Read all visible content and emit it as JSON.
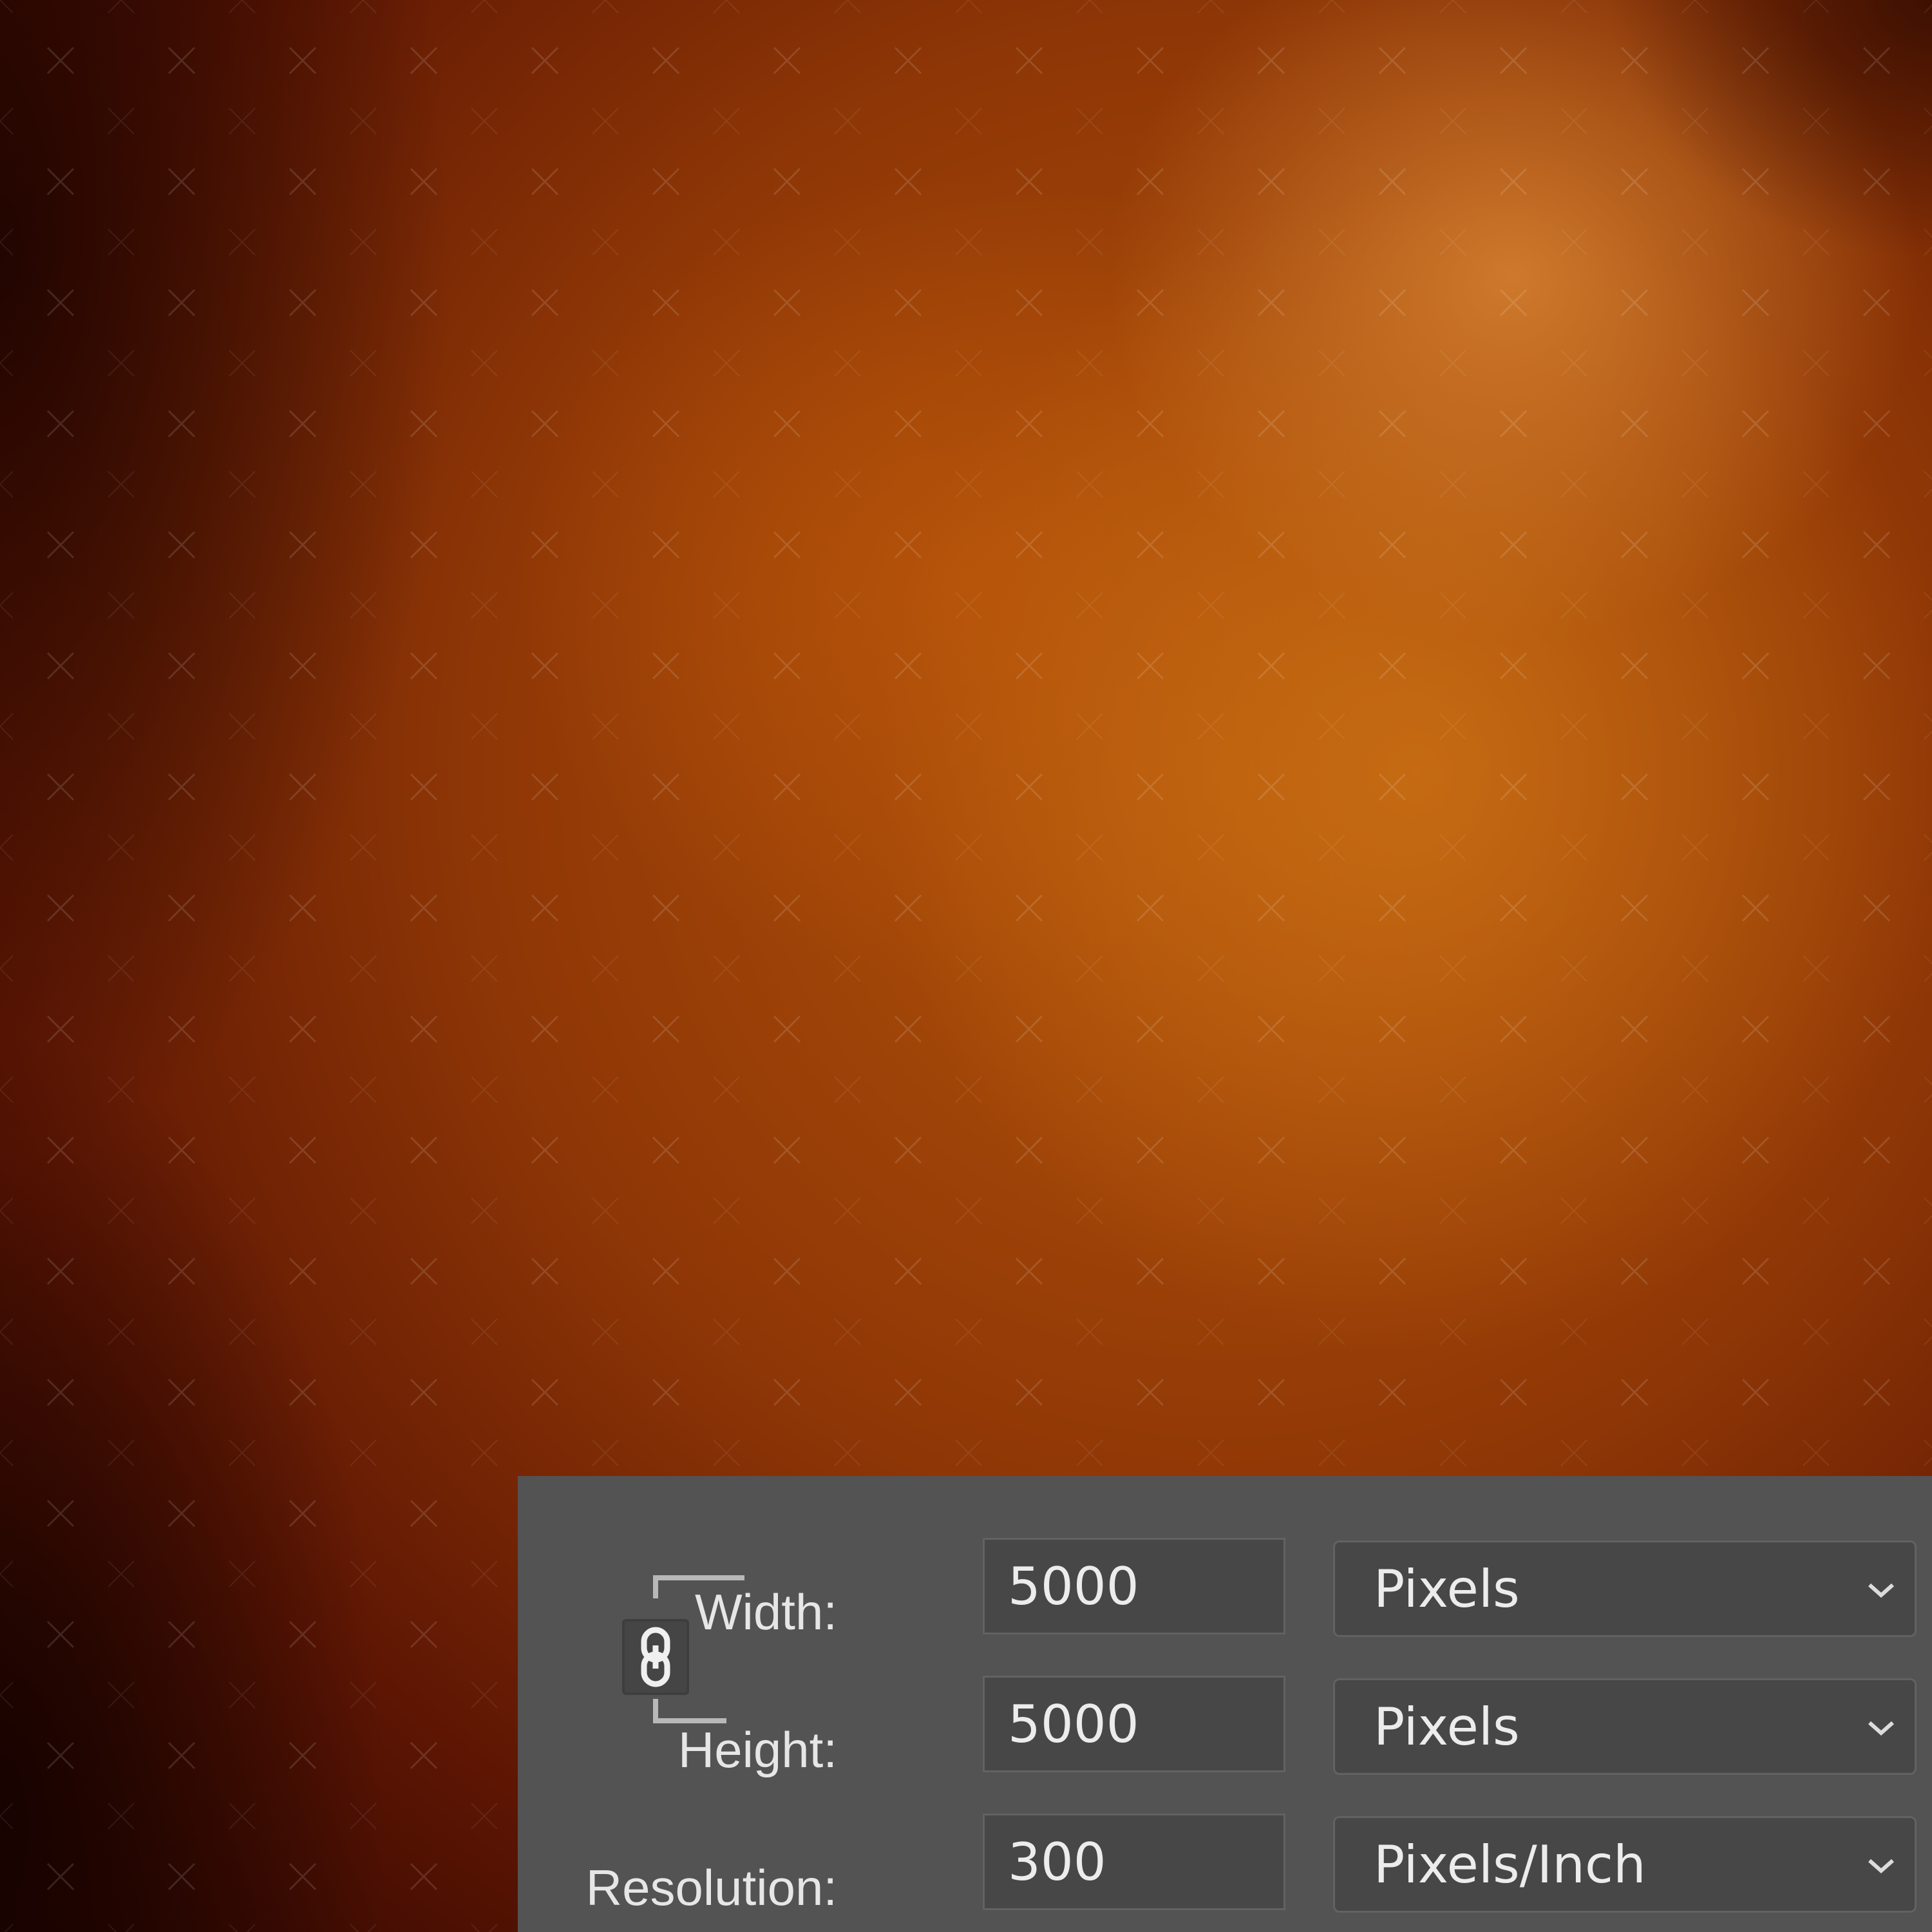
{
  "image_size_panel": {
    "constrain_icon": "chain-link-icon",
    "rows": [
      {
        "label": "Width:",
        "value": "5000",
        "unit": "Pixels"
      },
      {
        "label": "Height:",
        "value": "5000",
        "unit": "Pixels"
      },
      {
        "label": "Resolution:",
        "value": "300",
        "unit": "Pixels/Inch"
      }
    ],
    "dropdown_icon": "chevron-down-icon"
  },
  "colors": {
    "panel_background": "#535353",
    "field_background": "#474747",
    "label_text": "#e6e6e6",
    "canvas_accent": "#c0650f"
  }
}
